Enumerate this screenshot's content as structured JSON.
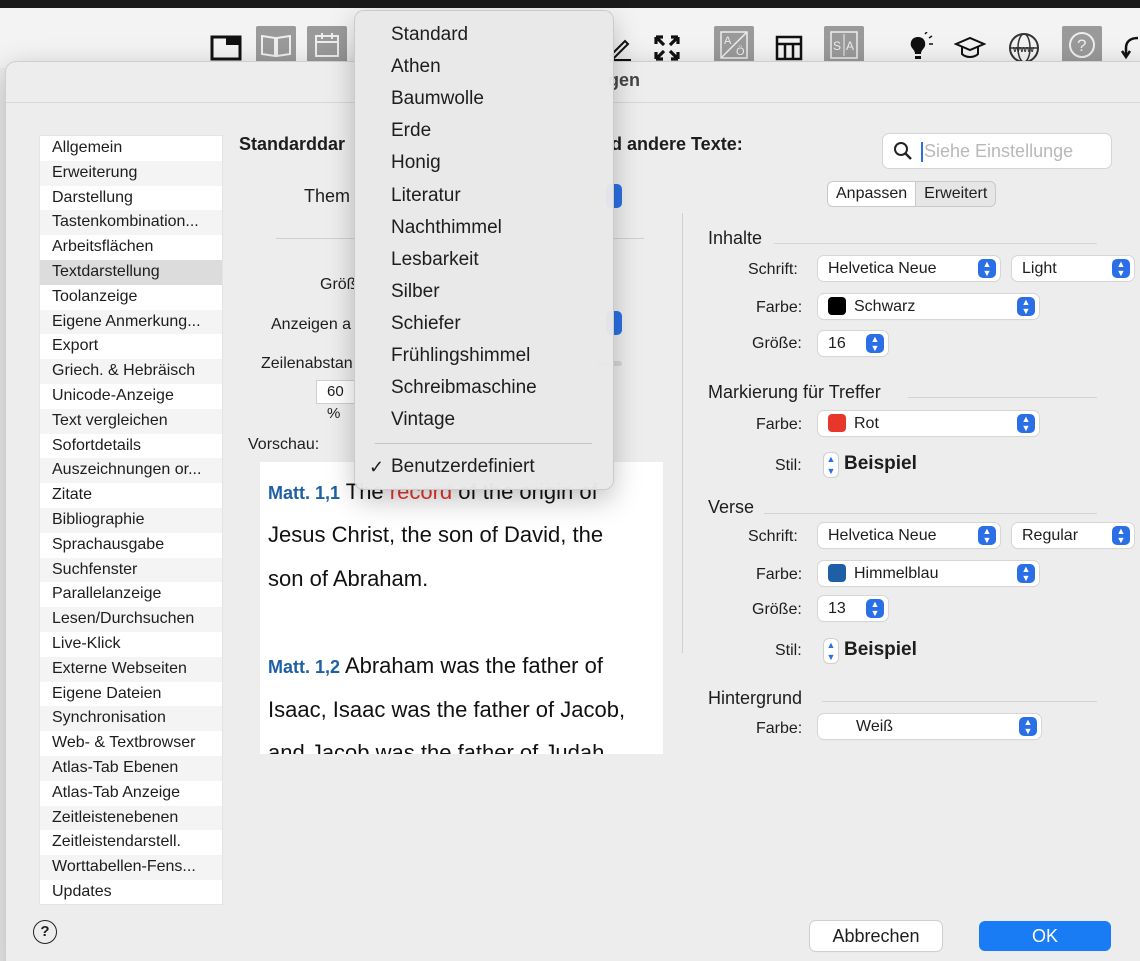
{
  "dialog": {
    "title_fragment": "gen"
  },
  "toolbar_icons": [
    "window-icon",
    "book-icon",
    "calendar-icon",
    "pencil-icon",
    "fullscreen-icon",
    "translation-icon",
    "table-icon",
    "text-compare-icon",
    "lightbulb-icon",
    "graduation-cap-icon",
    "www-globe-icon",
    "help-icon",
    "sync-icon"
  ],
  "sidebar": {
    "items": [
      "Allgemein",
      "Erweiterung",
      "Darstellung",
      "Tastenkombination...",
      "Arbeitsflächen",
      "Textdarstellung",
      "Toolanzeige",
      "Eigene Anmerkung...",
      "Export",
      "Griech. & Hebräisch",
      "Unicode-Anzeige",
      "Text vergleichen",
      "Sofortdetails",
      "Auszeichnungen or...",
      "Zitate",
      "Bibliographie",
      "Sprachausgabe",
      "Suchfenster",
      "Parallelanzeige",
      "Lesen/Durchsuchen",
      "Live-Klick",
      "Externe Webseiten",
      "Eigene Dateien",
      "Synchronisation",
      "Web- & Textbrowser",
      "Atlas-Tab Ebenen",
      "Atlas-Tab Anzeige",
      "Zeitleistenebenen",
      "Zeitleistendarstell.",
      "Worttabellen-Fens...",
      "Updates"
    ],
    "selected": "Textdarstellung"
  },
  "main": {
    "heading_start": "Standarddar",
    "heading_end": "d andere Texte:",
    "theme_label": "Them",
    "size_label": "Größ",
    "show_label": "Anzeigen a",
    "line_spacing_label": "Zeilenabstan",
    "line_spacing_value": "60 %",
    "preview_label": "Vorschau:"
  },
  "preview": {
    "verse1_ref": "Matt. 1,1",
    "verse1_pre": "The",
    "verse1_highlight": "record",
    "verse1_post": "of the origin of",
    "verse1_line2": "Jesus Christ, the son of David, the",
    "verse1_line3": "son of Abraham.",
    "verse2_ref": "Matt. 1,2",
    "verse2_line1": "Abraham was the father of",
    "verse2_line2": "Isaac, Isaac was the father of Jacob,",
    "verse2_line3": "and Jacob was the father of Judah"
  },
  "search": {
    "placeholder": "Siehe Einstellunge"
  },
  "segmented": {
    "adjust": "Anpassen",
    "advanced": "Erweitert"
  },
  "inhalte": {
    "title": "Inhalte",
    "font_label": "Schrift:",
    "font": "Helvetica Neue",
    "weight": "Light",
    "color_label": "Farbe:",
    "color": "Schwarz",
    "color_hex": "#000000",
    "size_label": "Größe:",
    "size": "16"
  },
  "markierung": {
    "title": "Markierung für Treffer",
    "color_label": "Farbe:",
    "color": "Rot",
    "color_hex": "#e8362a",
    "style_label": "Stil:",
    "style_sample": "Beispiel"
  },
  "verse": {
    "title": "Verse",
    "font_label": "Schrift:",
    "font": "Helvetica Neue",
    "weight": "Regular",
    "color_label": "Farbe:",
    "color": "Himmelblau",
    "color_hex": "#1f5fa6",
    "size_label": "Größe:",
    "size": "13",
    "style_label": "Stil:",
    "style_sample": "Beispiel"
  },
  "hintergrund": {
    "title": "Hintergrund",
    "color_label": "Farbe:",
    "color": "Weiß"
  },
  "buttons": {
    "cancel": "Abbrechen",
    "ok": "OK"
  },
  "theme_menu": {
    "items": [
      "Standard",
      "Athen",
      "Baumwolle",
      "Erde",
      "Honig",
      "Literatur",
      "Nachthimmel",
      "Lesbarkeit",
      "Silber",
      "Schiefer",
      "Frühlingshimmel",
      "Schreibmaschine",
      "Vintage"
    ],
    "checked_item": "Benutzerdefiniert",
    "checkmark": "✓"
  },
  "colors": {
    "accent": "#2b6fe6",
    "ok_button": "#1a7cf5",
    "verse_ref": "#1f5fa6",
    "highlight": "#e8362a"
  }
}
